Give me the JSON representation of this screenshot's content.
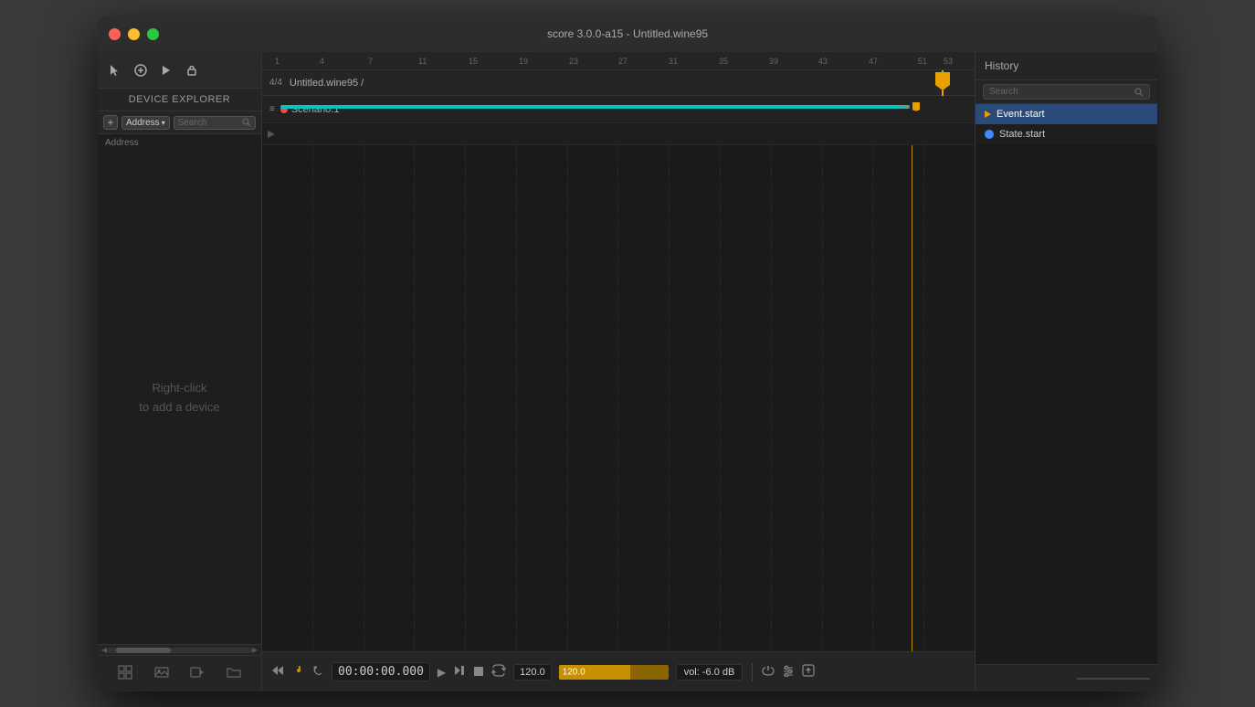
{
  "window": {
    "title": "score 3.0.0-a15 - Untitled.wine95"
  },
  "toolbar": {
    "icons": [
      "cursor",
      "add",
      "play",
      "lock"
    ]
  },
  "device_explorer": {
    "header": "DEVICE EXPLORER",
    "add_label": "+",
    "dropdown_label": "Address",
    "search_placeholder": "Search",
    "address_label": "Address",
    "empty_text": "Right-click\nto add a device"
  },
  "timeline": {
    "time_signature": "4/4",
    "title": "Untitled.wine95 /",
    "ruler_marks": [
      "1",
      "4",
      "7",
      "11",
      "15",
      "19",
      "23",
      "27",
      "31",
      "35",
      "39",
      "43",
      "47",
      "51",
      "53"
    ],
    "scenario_name": "Scenario.1"
  },
  "transport": {
    "timecode": "00:00:00.000",
    "tempo_value": "120.0",
    "volume_label": "vol: -6.0 dB"
  },
  "history": {
    "header": "History",
    "search_placeholder": "Search",
    "items": [
      {
        "label": "Event.start",
        "icon_color": "yellow",
        "selected": true
      },
      {
        "label": "State.start",
        "icon_color": "blue",
        "selected": false
      }
    ]
  }
}
